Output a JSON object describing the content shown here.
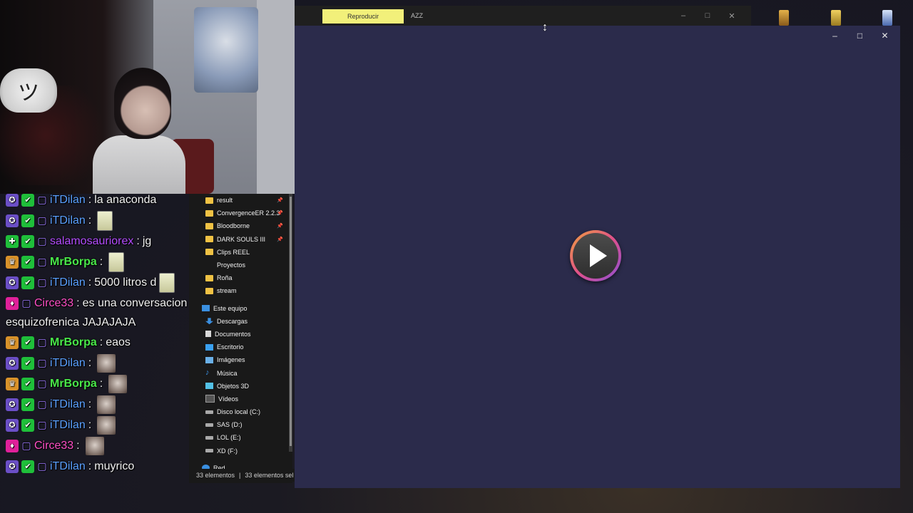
{
  "chat": {
    "messages": [
      {
        "user": "iTDilan",
        "text": "la anaconda",
        "color": "blue",
        "emote": false
      },
      {
        "user": "iTDilan",
        "text": "",
        "color": "blue",
        "emote": "sticker"
      },
      {
        "user": "salamosauriorex",
        "text": "jg",
        "color": "purple",
        "emote": false
      },
      {
        "user": "MrBorpa",
        "text": "",
        "color": "green",
        "emote": "sticker"
      },
      {
        "user": "iTDilan",
        "text": "5000 litros d",
        "color": "blue",
        "emote": "sticker"
      },
      {
        "user": "Circe33",
        "text": "es una conversacion",
        "color": "pink",
        "emote": false
      },
      {
        "user": "",
        "text": "esquizofrenica JAJAJAJA",
        "color": "",
        "emote": false
      },
      {
        "user": "MrBorpa",
        "text": "eaos",
        "color": "green",
        "emote": false
      },
      {
        "user": "iTDilan",
        "text": "",
        "color": "blue",
        "emote": "face"
      },
      {
        "user": "MrBorpa",
        "text": "",
        "color": "green",
        "emote": "face"
      },
      {
        "user": "iTDilan",
        "text": "",
        "color": "blue",
        "emote": "face"
      },
      {
        "user": "iTDilan",
        "text": "",
        "color": "blue",
        "emote": "face"
      },
      {
        "user": "Circe33",
        "text": "",
        "color": "pink",
        "emote": "face"
      },
      {
        "user": "iTDilan",
        "text": "muyrico",
        "color": "blue",
        "emote": false
      }
    ]
  },
  "explorer": {
    "quick_access": [
      {
        "label": "result",
        "pinned": true
      },
      {
        "label": "ConvergenceER 2.2.3",
        "pinned": true
      },
      {
        "label": "Bloodborne",
        "pinned": true
      },
      {
        "label": "DARK SOULS III",
        "pinned": true
      },
      {
        "label": "Clips REEL",
        "pinned": false
      },
      {
        "label": "Proyectos",
        "pinned": false
      },
      {
        "label": "Roña",
        "pinned": false
      },
      {
        "label": "stream",
        "pinned": false
      }
    ],
    "this_pc_label": "Este equipo",
    "this_pc": [
      {
        "label": "Descargas",
        "icon": "download-icon"
      },
      {
        "label": "Documentos",
        "icon": "document-icon"
      },
      {
        "label": "Escritorio",
        "icon": "desktop-icon"
      },
      {
        "label": "Imágenes",
        "icon": "image-icon"
      },
      {
        "label": "Música",
        "icon": "music-icon"
      },
      {
        "label": "Objetos 3D",
        "icon": "cube-icon"
      },
      {
        "label": "Vídeos",
        "icon": "video-icon"
      },
      {
        "label": "Disco local (C:)",
        "icon": "drive-icon"
      },
      {
        "label": "SAS (D:)",
        "icon": "drive-icon"
      },
      {
        "label": "LOL (E:)",
        "icon": "drive-icon"
      },
      {
        "label": "XD (F:)",
        "icon": "drive-icon"
      }
    ],
    "network_label": "Red",
    "status_count": "33 elementos",
    "status_selected": "33 elementos sel"
  },
  "background_window": {
    "play_tab": "Reproducir",
    "title": "AZZ"
  },
  "player": {
    "play_button": "play-icon"
  }
}
